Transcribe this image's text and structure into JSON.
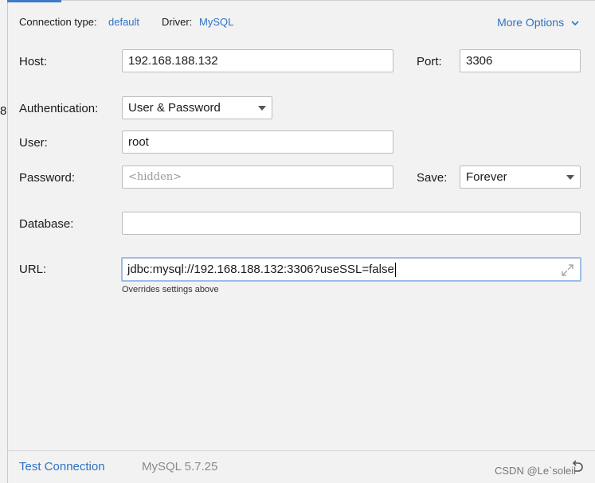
{
  "header": {
    "connection_type_label": "Connection type:",
    "connection_type_value": "default",
    "driver_label": "Driver:",
    "driver_value": "MySQL",
    "more_options": "More Options"
  },
  "left_strip_glyph": "8",
  "form": {
    "host_label": "Host:",
    "host_value": "192.168.188.132",
    "port_label": "Port:",
    "port_value": "3306",
    "auth_label": "Authentication:",
    "auth_value": "User & Password",
    "user_label": "User:",
    "user_value": "root",
    "password_label": "Password:",
    "password_placeholder": "<hidden>",
    "save_label": "Save:",
    "save_value": "Forever",
    "database_label": "Database:",
    "database_value": "",
    "url_label": "URL:",
    "url_value": "jdbc:mysql://192.168.188.132:3306?useSSL=false",
    "url_hint": "Overrides settings above"
  },
  "footer": {
    "test_connection": "Test Connection",
    "driver_version": "MySQL 5.7.25",
    "watermark": "CSDN @Le`soleil"
  },
  "colors": {
    "link": "#2f72c4",
    "focus_border": "#9dbde6",
    "background": "#f2f2f2"
  },
  "icons": {
    "more_options": "chevron-down-icon",
    "url_expand": "expand-icon",
    "revert": "undo-icon"
  }
}
